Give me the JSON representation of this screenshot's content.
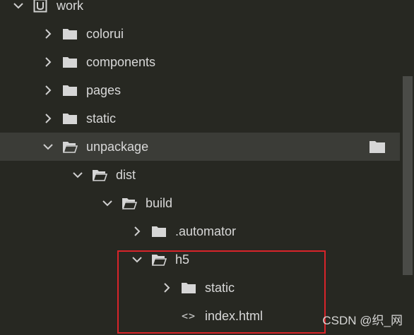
{
  "tree": {
    "items": [
      {
        "label": "work",
        "icon": "project-icon",
        "expanded": true
      },
      {
        "label": "colorui",
        "icon": "folder-icon",
        "expanded": false
      },
      {
        "label": "components",
        "icon": "folder-icon",
        "expanded": false
      },
      {
        "label": "pages",
        "icon": "folder-icon",
        "expanded": false
      },
      {
        "label": "static",
        "icon": "folder-icon",
        "expanded": false
      },
      {
        "label": "unpackage",
        "icon": "folder-open-icon",
        "expanded": true,
        "selected": true
      },
      {
        "label": "dist",
        "icon": "folder-open-icon",
        "expanded": true
      },
      {
        "label": "build",
        "icon": "folder-open-icon",
        "expanded": true
      },
      {
        "label": ".automator",
        "icon": "folder-icon",
        "expanded": false
      },
      {
        "label": "h5",
        "icon": "folder-open-icon",
        "expanded": true
      },
      {
        "label": "static",
        "icon": "folder-icon",
        "expanded": false
      },
      {
        "label": "index.html",
        "icon": "code-file-icon",
        "glyph": "<>"
      }
    ]
  },
  "watermark": "CSDN @织_网",
  "colors": {
    "background": "#272822",
    "selected_row": "#3b3c37",
    "highlight_border": "#d8242a",
    "text": "#d8d8d8"
  }
}
